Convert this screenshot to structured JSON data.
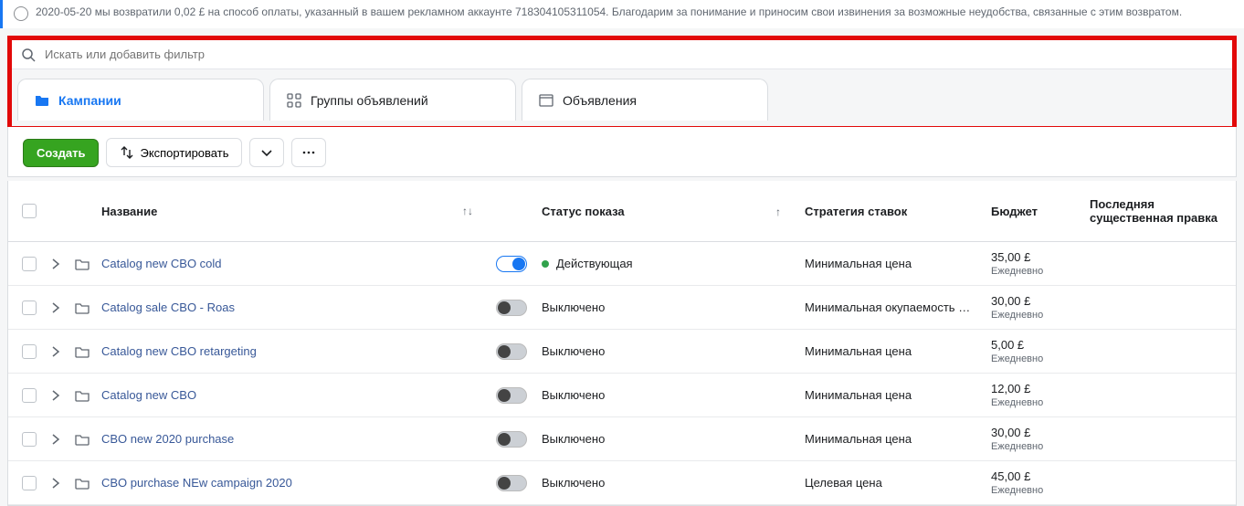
{
  "notice": {
    "text": "2020-05-20 мы возвратили 0,02 £ на способ оплаты, указанный в вашем рекламном аккаунте 718304105311054. Благодарим за понимание и приносим свои извинения за возможные неудобства, связанные с этим возвратом."
  },
  "search": {
    "placeholder": "Искать или добавить фильтр"
  },
  "tabs": {
    "campaigns": "Кампании",
    "adsets": "Группы объявлений",
    "ads": "Объявления"
  },
  "toolbar": {
    "create": "Создать",
    "export": "Экспортировать"
  },
  "headers": {
    "name": "Название",
    "status": "Статус показа",
    "strategy": "Стратегия ставок",
    "budget": "Бюджет",
    "lastedit": "Последняя существенная правка"
  },
  "status_labels": {
    "active": "Действующая",
    "off": "Выключено"
  },
  "budget_period": "Ежедневно",
  "rows": [
    {
      "name": "Catalog new CBO cold",
      "on": true,
      "status": "active",
      "strategy": "Минимальная цена",
      "budget": "35,00 £"
    },
    {
      "name": "Catalog sale CBO - Roas",
      "on": false,
      "status": "off",
      "strategy": "Минимальная окупаемость …",
      "budget": "30,00 £"
    },
    {
      "name": "Catalog new CBO retargeting",
      "on": false,
      "status": "off",
      "strategy": "Минимальная цена",
      "budget": "5,00 £"
    },
    {
      "name": "Catalog new CBO",
      "on": false,
      "status": "off",
      "strategy": "Минимальная цена",
      "budget": "12,00 £"
    },
    {
      "name": "CBO new 2020 purchase",
      "on": false,
      "status": "off",
      "strategy": "Минимальная цена",
      "budget": "30,00 £"
    },
    {
      "name": "CBO purchase NEw campaign 2020",
      "on": false,
      "status": "off",
      "strategy": "Целевая цена",
      "budget": "45,00 £"
    }
  ]
}
